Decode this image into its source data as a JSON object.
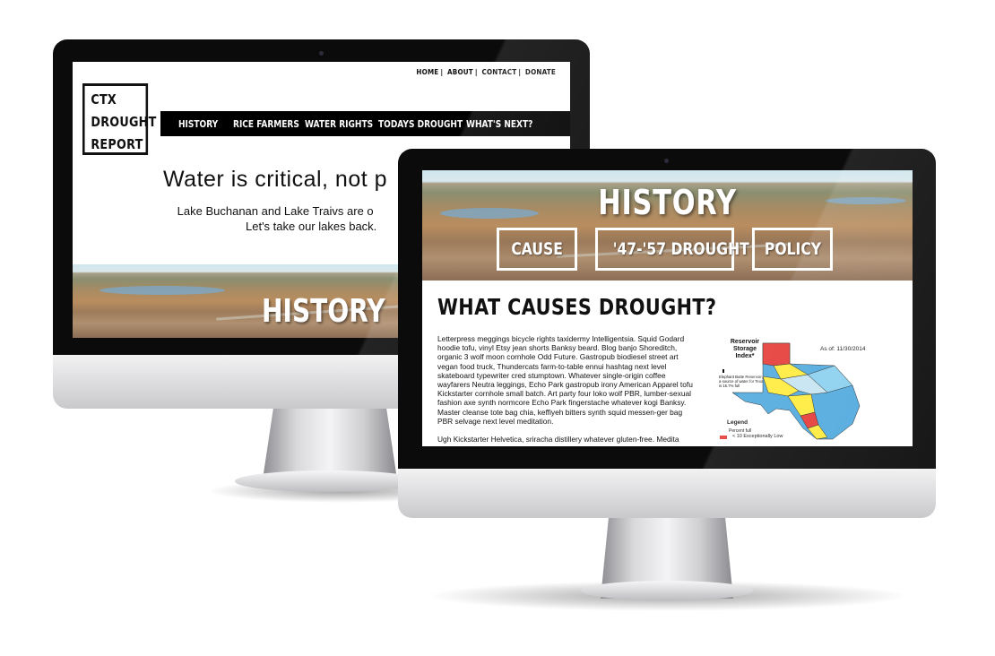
{
  "back_site": {
    "top_links": [
      "HOME",
      "ABOUT",
      "CONTACT",
      "DONATE"
    ],
    "logo_lines": [
      "CTX",
      "DROUGHT",
      "REPORT"
    ],
    "nav": [
      "HISTORY",
      "RICE FARMERS",
      "WATER RIGHTS",
      "TODAYS DROUGHT",
      "WHAT'S NEXT?"
    ],
    "headline": "Water is critical, not p",
    "subtext_line1": "Lake Buchanan and Lake Traivs are o",
    "subtext_line2": "Let's take our lakes back.",
    "banner_title": "HISTORY"
  },
  "front_site": {
    "banner_title": "HISTORY",
    "buttons": [
      "CAUSE",
      "'47-'57 DROUGHT",
      "POLICY"
    ],
    "heading": "WHAT CAUSES DROUGHT?",
    "paragraph1": "Letterpress meggings bicycle rights taxidermy Intelligentsia. Squid Godard hoodie tofu, vinyl Etsy jean shorts Banksy beard. Blog banjo Shoreditch, organic 3 wolf moon cornhole Odd Future. Gastropub biodiesel street art vegan food truck, Thundercats farm-to-table ennui hashtag next level skateboard typewriter cred stumptown. Whatever single-origin coffee wayfarers Neutra leggings, Echo Park gastropub irony American Apparel tofu Kickstarter cornhole small batch. Art party four loko wolf PBR, lumber-sexual fashion axe synth normcore Echo Park fingerstache whatever kogi Banksy. Master cleanse tote bag chia, keffiyeh bitters synth squid messen-ger bag PBR selvage next level meditation.",
    "paragraph2": "Ugh Kickstarter Helvetica, sriracha distillery whatever gluten-free. Medita",
    "map": {
      "title": "Reservoir Storage Index*",
      "date": "As of: 11/30/2014",
      "note": "Elephant Butte Reservoir, a source of water for Texas is 15.7% full",
      "legend_title": "Legend",
      "legend_sub": "Percent full",
      "legend_item": "< 10   Exceptionally Low"
    }
  },
  "colors": {
    "bezel": "#0b0b0b",
    "nav_bg": "#000000",
    "text": "#111111"
  }
}
